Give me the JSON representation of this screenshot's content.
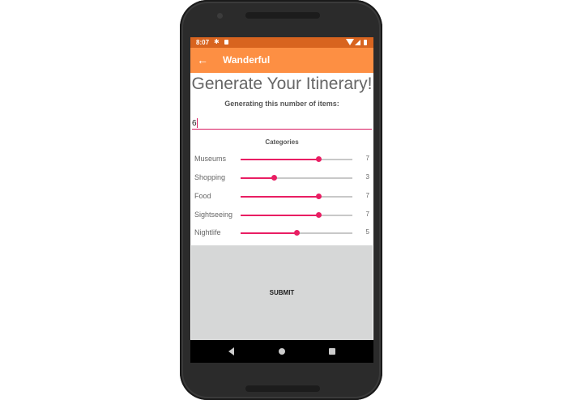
{
  "status_bar": {
    "time": "8:07"
  },
  "app_bar": {
    "title": "Wanderful",
    "back_icon": "arrow-back-icon"
  },
  "main": {
    "title": "Generate Your Itinerary!",
    "count_label": "Generating this number of items:",
    "count_value": "6",
    "categories_header": "Categories",
    "slider_max": 10,
    "categories": [
      {
        "name": "Museums",
        "value": 7
      },
      {
        "name": "Shopping",
        "value": 3
      },
      {
        "name": "Food",
        "value": 7
      },
      {
        "name": "Sightseeing",
        "value": 7
      },
      {
        "name": "Nightlife",
        "value": 5
      }
    ],
    "submit_label": "SUBMIT"
  },
  "colors": {
    "status_bar": "#d8641f",
    "app_bar": "#fd8f43",
    "accent": "#e91e63"
  }
}
